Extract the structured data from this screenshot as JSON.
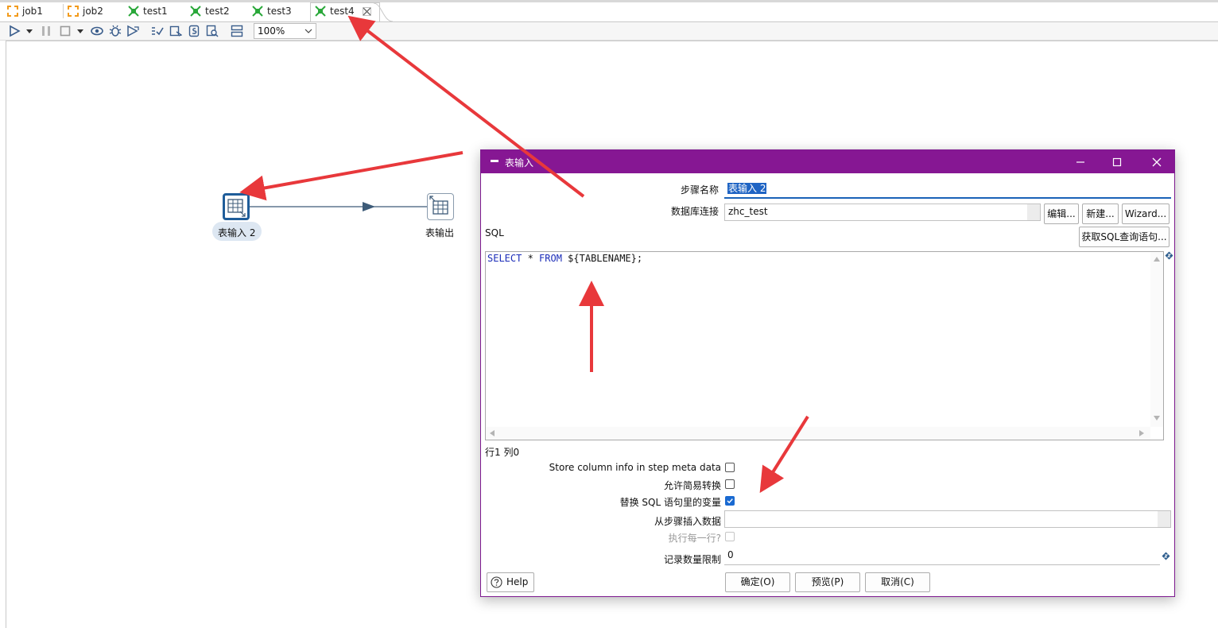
{
  "tabs": [
    {
      "label": "job1",
      "kind": "job"
    },
    {
      "label": "job2",
      "kind": "job"
    },
    {
      "label": "test1",
      "kind": "transformation"
    },
    {
      "label": "test2",
      "kind": "transformation"
    },
    {
      "label": "test3",
      "kind": "transformation"
    },
    {
      "label": "test4",
      "kind": "transformation",
      "active": true
    }
  ],
  "toolbar": {
    "zoom": "100%",
    "icons": [
      "run-icon",
      "run-dropdown-icon",
      "pause-icon",
      "stop-icon",
      "stop-dropdown-icon",
      "preview-icon",
      "debug-icon",
      "replay-icon",
      "verify-icon",
      "analyze-impact-icon",
      "sql-icon",
      "explore-db-icon",
      "show-results-icon"
    ]
  },
  "canvas": {
    "steps": [
      {
        "label": "表输入 2",
        "kind": "table-input",
        "selected": true
      },
      {
        "label": "表输出",
        "kind": "table-output"
      }
    ]
  },
  "dialog": {
    "title": "表输入",
    "step_name_label": "步骤名称",
    "step_name_value": "表输入 2",
    "connection_label": "数据库连接",
    "connection_value": "zhc_test",
    "edit_button": "编辑...",
    "new_button": "新建...",
    "wizard_button": "Wizard...",
    "sql_label": "SQL",
    "get_sql_button": "获取SQL查询语句...",
    "sql": {
      "keyword1": "SELECT",
      "star": " * ",
      "keyword2": "FROM",
      "rest": " ${TABLENAME};"
    },
    "cursor_position": "行1 列0",
    "store_column_info_label": "Store column info in step meta data",
    "store_column_info_checked": false,
    "lazy_conversion_label": "允许简易转换",
    "lazy_conversion_checked": false,
    "replace_variables_label": "替换 SQL 语句里的变量",
    "replace_variables_checked": true,
    "insert_from_step_label": "从步骤插入数据",
    "insert_from_step_value": "",
    "execute_each_row_label": "执行每一行?",
    "execute_each_row_checked": false,
    "limit_label": "记录数量限制",
    "limit_value": "0",
    "help_button": "Help",
    "ok_button": "确定(O)",
    "preview_button": "预览(P)",
    "cancel_button": "取消(C)"
  },
  "colors": {
    "dialog_title_bar": "#861793",
    "annotation_arrow": "#e8383b",
    "hop": "#3d5b78",
    "checkbox_checked": "#1a6ad1"
  }
}
